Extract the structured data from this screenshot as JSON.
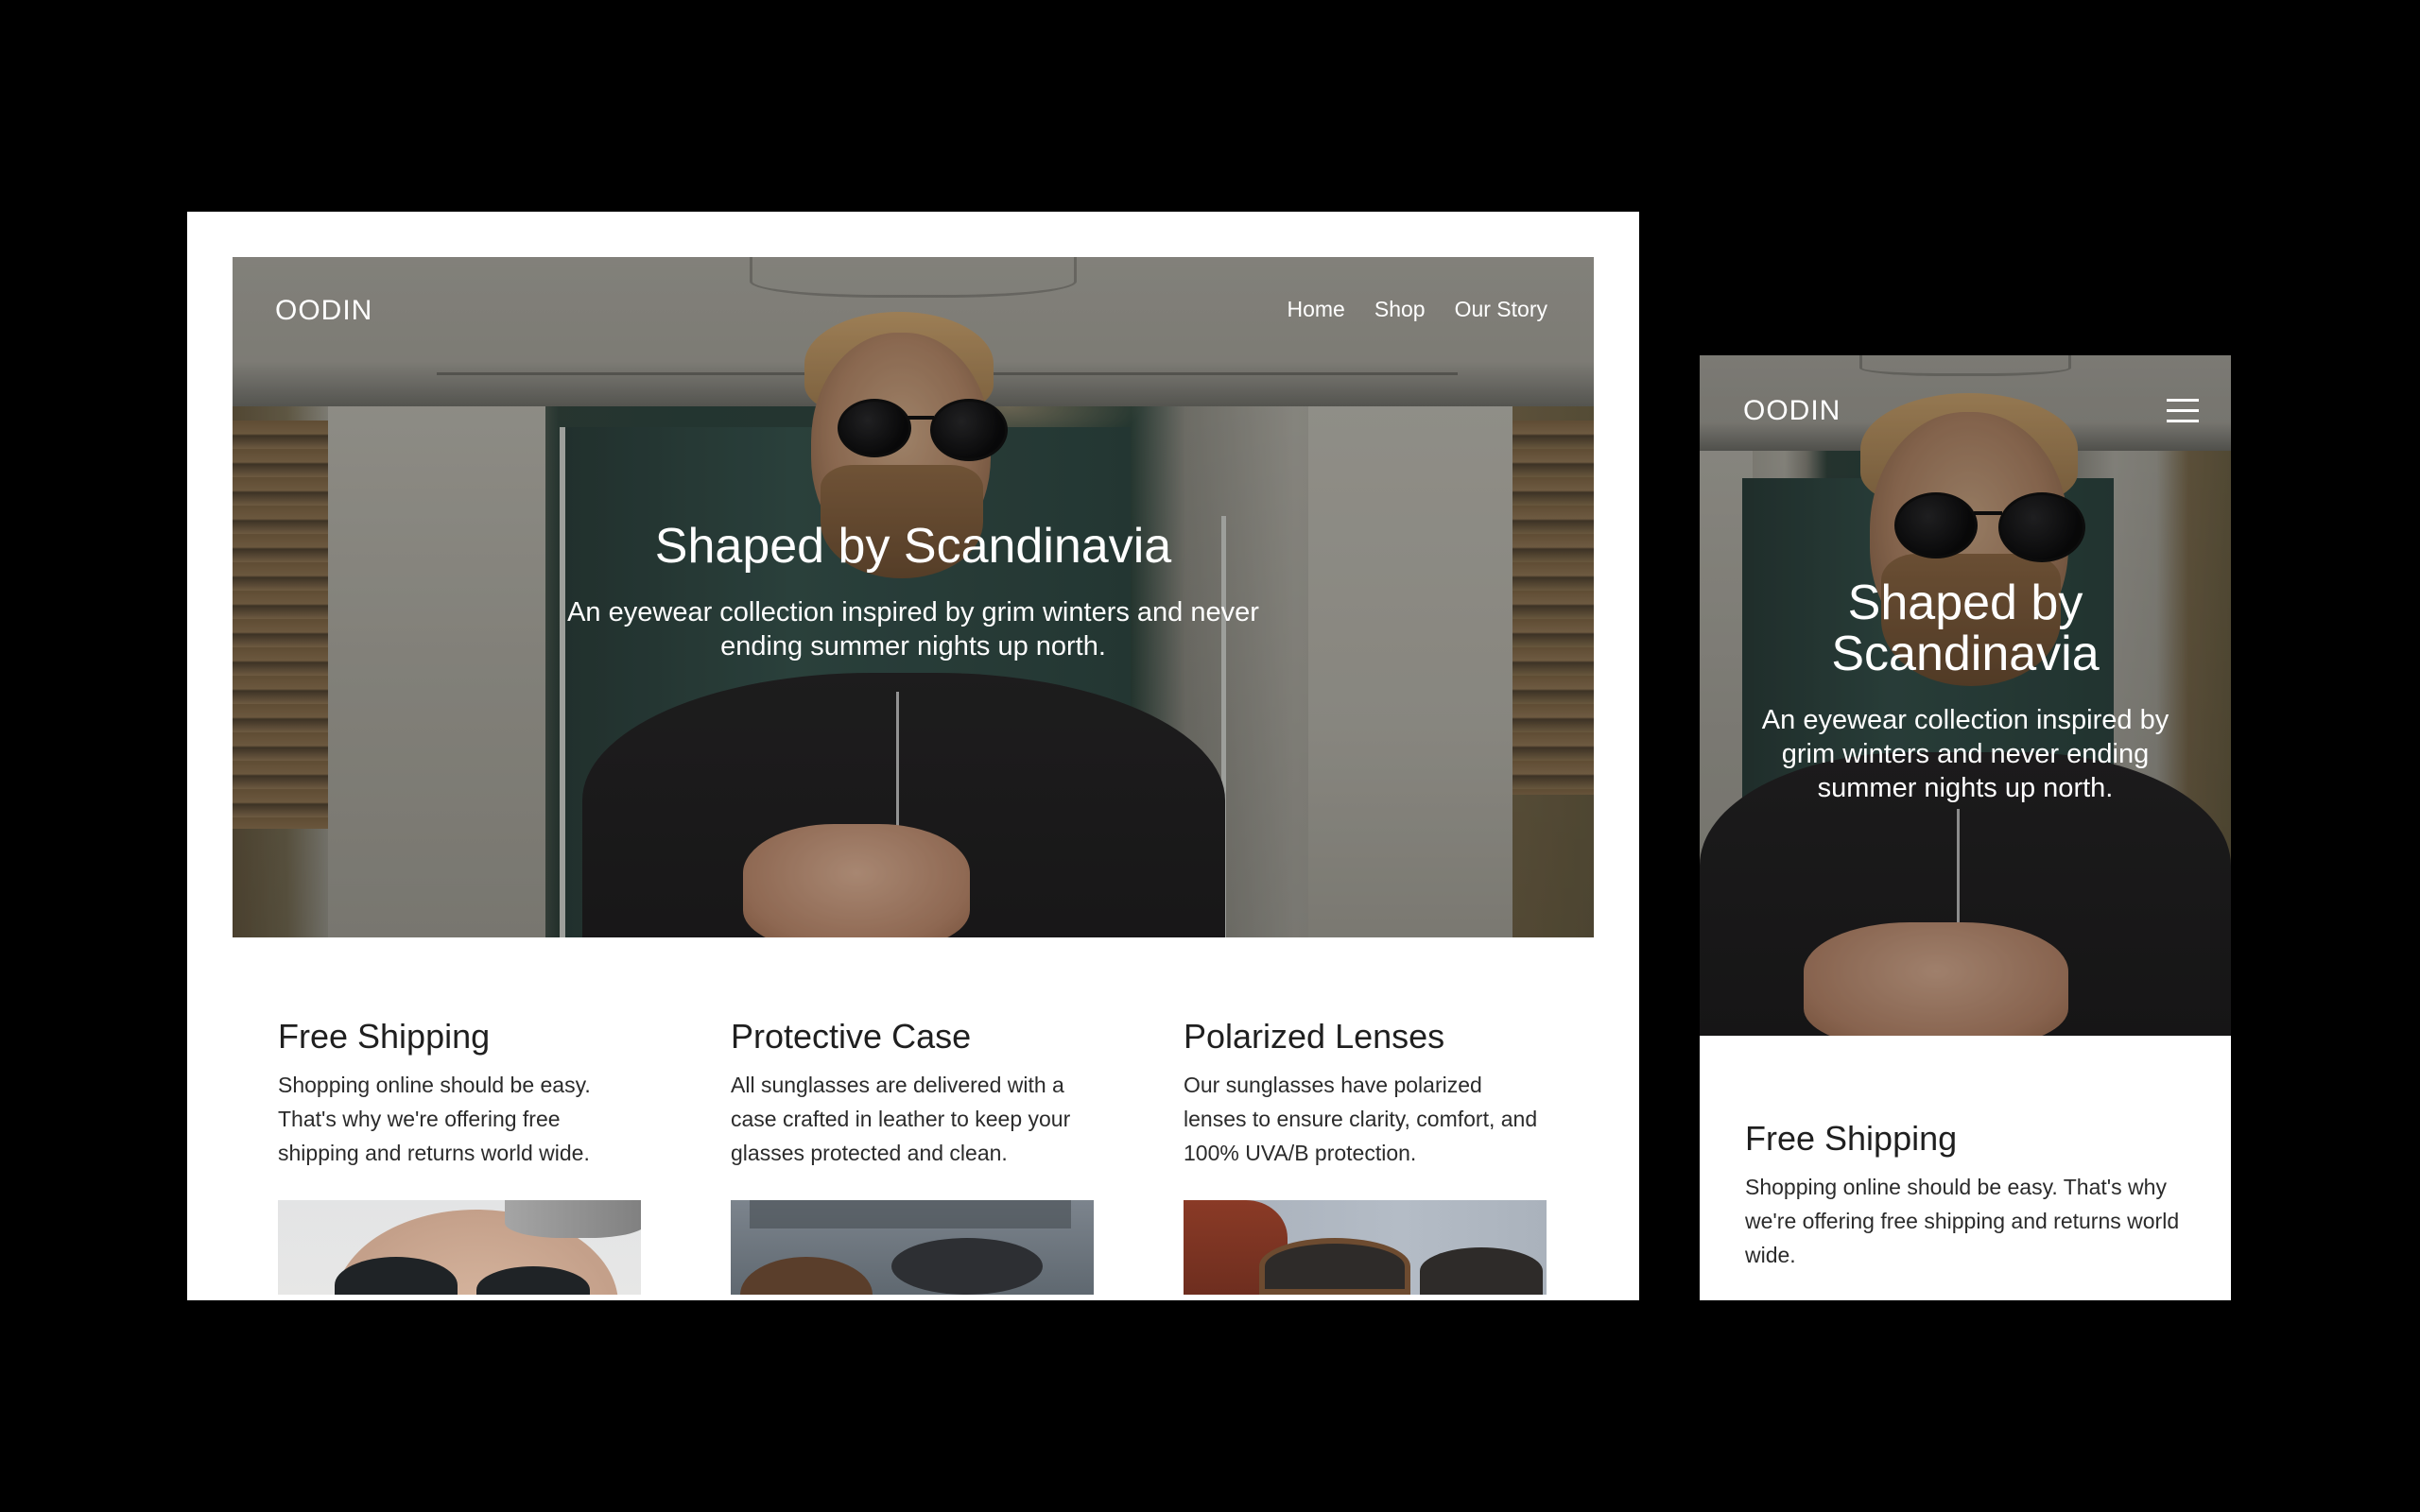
{
  "brand": "OODIN",
  "nav": {
    "home": "Home",
    "shop": "Shop",
    "story": "Our Story"
  },
  "hero": {
    "title": "Shaped by Scandinavia",
    "subtitle": "An eyewear collection inspired by grim winters and never ending summer nights up north."
  },
  "features": [
    {
      "title": "Free Shipping",
      "body": "Shopping online should be easy. That's why we're offering free shipping and returns world wide."
    },
    {
      "title": "Protective Case",
      "body": "All sunglasses are delivered with a case crafted in leather to keep your glasses protected and clean."
    },
    {
      "title": "Polarized Lenses",
      "body": "Our sunglasses have polarized lenses to ensure clarity, comfort, and 100% UVA/B protection."
    }
  ],
  "mobile": {
    "menu_icon": "hamburger-menu-icon"
  },
  "colors": {
    "background": "#000000",
    "card": "#ffffff",
    "text": "#1f1f1f",
    "overlay_text": "#ffffff"
  }
}
